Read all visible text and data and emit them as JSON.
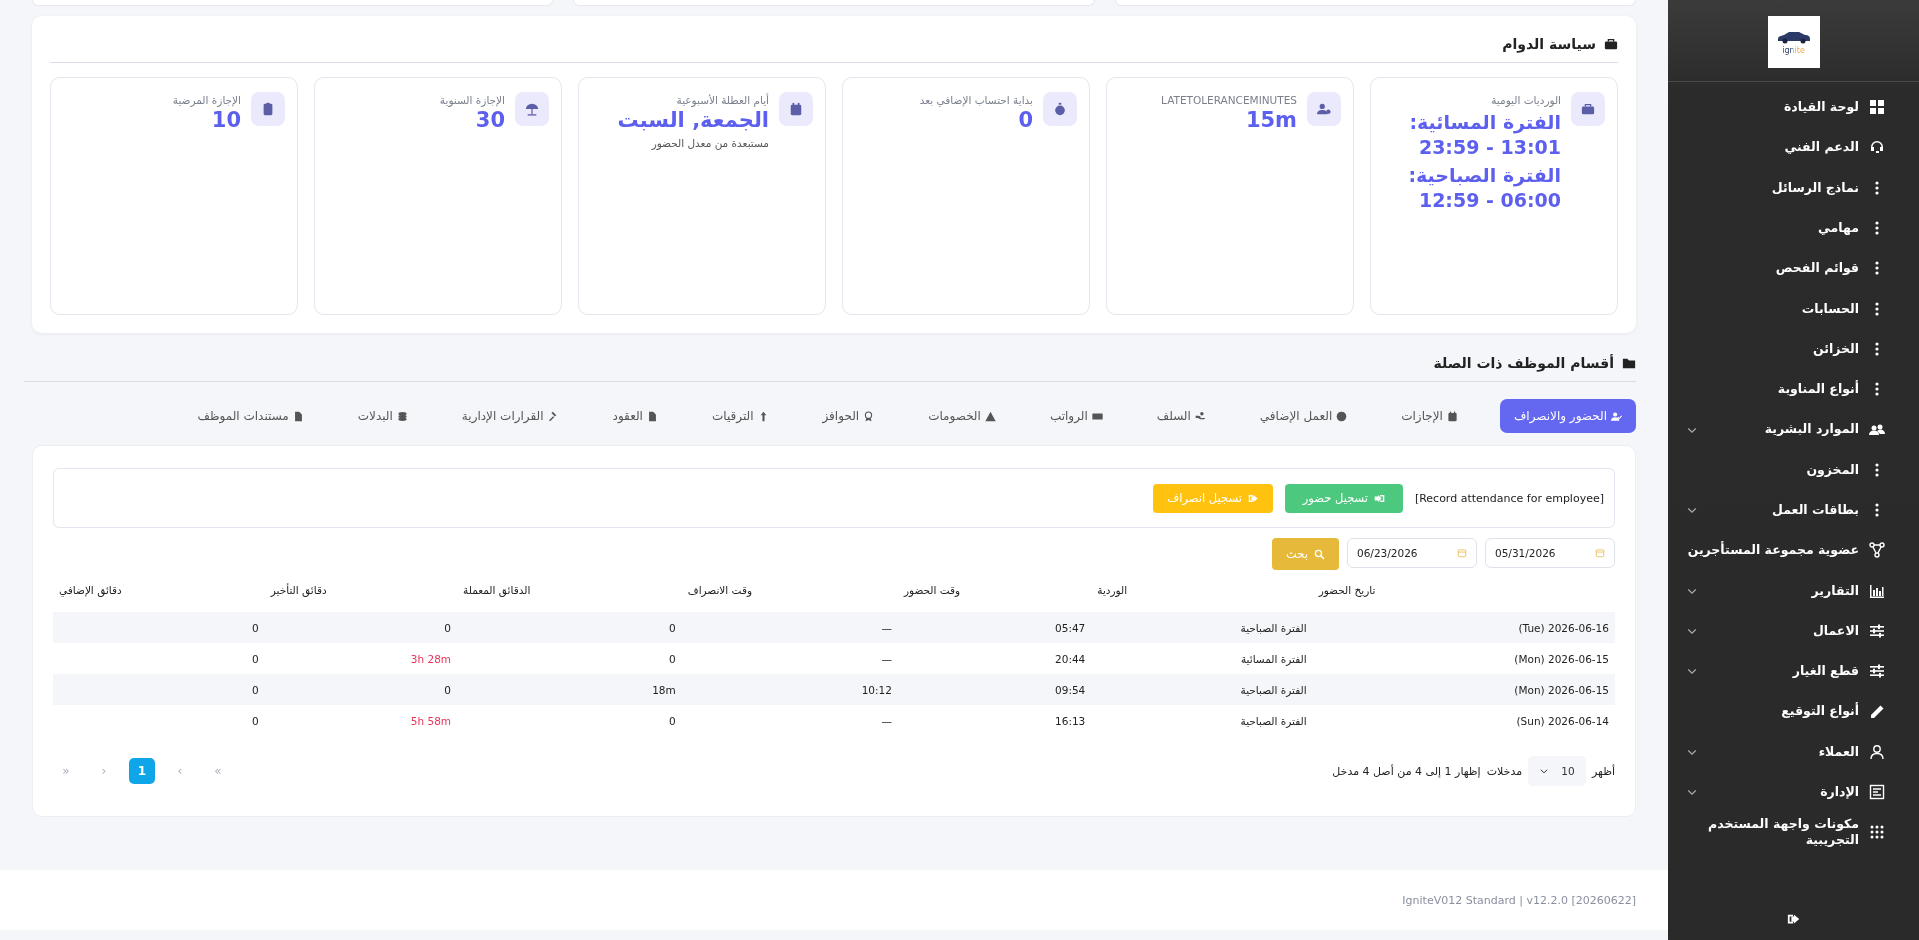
{
  "policy": {
    "title": "سياسة الدوام",
    "cards": [
      {
        "label": "الورديات اليومية",
        "values": [
          "الفترة المسائية: 13:01 - 23:59",
          "الفترة الصباحية: 06:00 - 12:59"
        ]
      },
      {
        "label": "LATETOLERANCEMINUTES",
        "values": [
          "15m"
        ]
      },
      {
        "label": "بداية احتساب الإضافي بعد",
        "values": [
          "0"
        ]
      },
      {
        "label": "أيام العطلة الأسبوعية",
        "values": [
          "الجمعة, السبت"
        ],
        "note": "مستبعدة من معدل الحضور"
      },
      {
        "label": "الإجازة السنوية",
        "values": [
          "30"
        ]
      },
      {
        "label": "الإجازة المرضية",
        "values": [
          "10"
        ]
      }
    ]
  },
  "sections": {
    "title": "أقسام الموظف ذات الصلة",
    "tabs": [
      {
        "label": "الحضور والانصراف",
        "selected": true
      },
      {
        "label": "الإجازات",
        "selected": false
      },
      {
        "label": "العمل الإضافي",
        "selected": false
      },
      {
        "label": "السلف",
        "selected": false
      },
      {
        "label": "الرواتب",
        "selected": false
      },
      {
        "label": "الخصومات",
        "selected": false
      },
      {
        "label": "الحوافز",
        "selected": false
      },
      {
        "label": "الترقيات",
        "selected": false
      },
      {
        "label": "العقود",
        "selected": false
      },
      {
        "label": "القرارات الإدارية",
        "selected": false
      },
      {
        "label": "البدلات",
        "selected": false
      },
      {
        "label": "مستندات الموظف",
        "selected": false
      }
    ]
  },
  "attendance": {
    "record_label": "[Record attendance for employee]",
    "check_in_button": "تسجيل حضور",
    "check_out_button": "تسجيل انصراف",
    "date_from": "05/31/2026",
    "date_to": "06/23/2026",
    "search_button": "بحث",
    "table": {
      "columns": [
        "تاريخ الحضور",
        "الوردية",
        "وقت الحضور",
        "وقت الانصراف",
        "الدقائق المعملة",
        "دقائق التأخير",
        "دقائق الإضافي"
      ],
      "rows": [
        {
          "cells": [
            "(Tue) 2026-06-16",
            "الفترة الصباحية",
            "05:47",
            "—",
            "0",
            "0",
            "0"
          ],
          "late": false
        },
        {
          "cells": [
            "(Mon) 2026-06-15",
            "الفترة المسائية",
            "20:44",
            "—",
            "0",
            "3h 28m",
            "0"
          ],
          "late": true
        },
        {
          "cells": [
            "(Mon) 2026-06-15",
            "الفترة الصباحية",
            "09:54",
            "10:12",
            "18m",
            "0",
            "0"
          ],
          "late": false
        },
        {
          "cells": [
            "(Sun) 2026-06-14",
            "الفترة الصباحية",
            "16:13",
            "—",
            "0",
            "5h 58m",
            "0"
          ],
          "late": true
        }
      ]
    },
    "length": {
      "show": "أظهر",
      "value": "10",
      "entries": "مدخلات"
    },
    "info": "إظهار 1 إلى 4 من أصل 4 مدخل",
    "pagination": [
      {
        "label": "»",
        "selected": false,
        "disabled": true
      },
      {
        "label": "›",
        "selected": false,
        "disabled": true
      },
      {
        "label": "1",
        "selected": true,
        "disabled": false
      },
      {
        "label": "‹",
        "selected": false,
        "disabled": true
      },
      {
        "label": "«",
        "selected": false,
        "disabled": true
      }
    ]
  },
  "footer": "IgniteV012 Standard | v12.2.0 [20260622]",
  "sidebar": {
    "logo": "ignite",
    "items": [
      {
        "label": "لوحة القيادة",
        "expandable": false
      },
      {
        "label": "الدعم الفني",
        "expandable": false
      },
      {
        "label": "نماذج الرسائل",
        "expandable": false
      },
      {
        "label": "مهامي",
        "expandable": false
      },
      {
        "label": "قوائم الفحص",
        "expandable": false
      },
      {
        "label": "الحسابات",
        "expandable": false
      },
      {
        "label": "الخزائن",
        "expandable": false
      },
      {
        "label": "أنواع المناوبة",
        "expandable": false
      },
      {
        "label": "الموارد البشرية",
        "expandable": true
      },
      {
        "label": "المخزون",
        "expandable": false
      },
      {
        "label": "بطاقات العمل",
        "expandable": true
      },
      {
        "label": "عضوية مجموعة المستأجرين",
        "expandable": false
      },
      {
        "label": "التقارير",
        "expandable": true
      },
      {
        "label": "الاعمال",
        "expandable": true
      },
      {
        "label": "قطع الغيار",
        "expandable": true
      },
      {
        "label": "أنواع التوقيع",
        "expandable": false
      },
      {
        "label": "العملاء",
        "expandable": true
      },
      {
        "label": "الإدارة",
        "expandable": true
      },
      {
        "label": "مكونات واجهة المستخدم التجريبية",
        "expandable": false
      }
    ]
  }
}
